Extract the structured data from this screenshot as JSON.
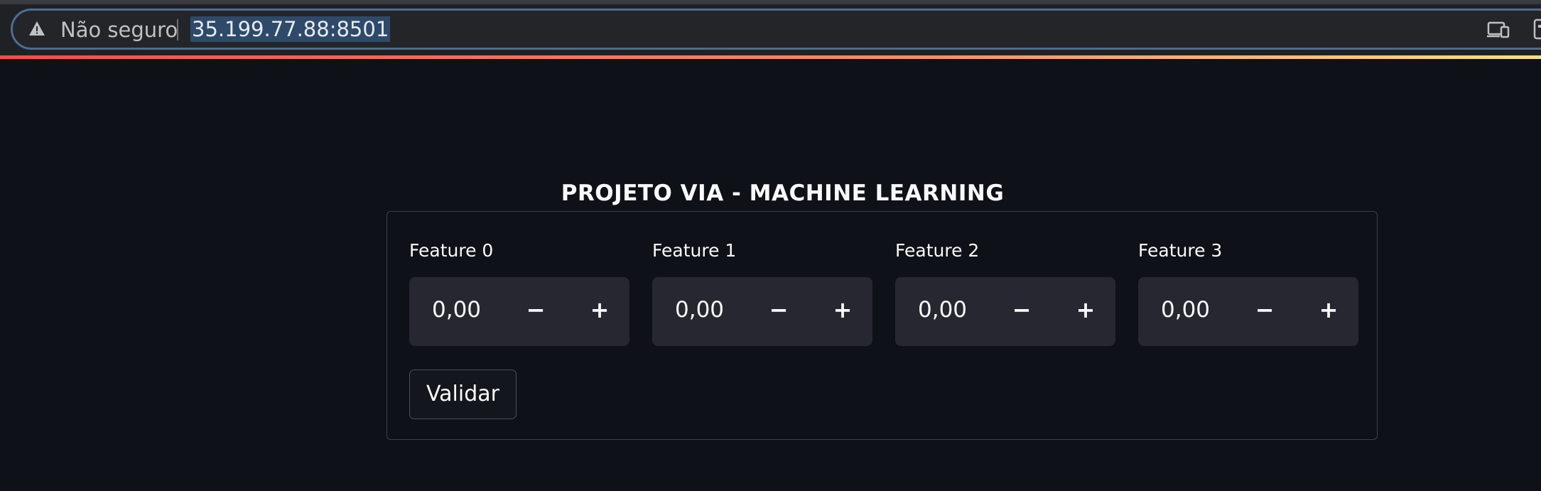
{
  "browser": {
    "security_label": "Não seguro",
    "url": "35.199.77.88:8501",
    "icons": {
      "warning": "warning-triangle-icon",
      "cast": "cast-icon",
      "extension": "extension-icon"
    }
  },
  "app": {
    "title": "PROJETO VIA - MACHINE LEARNING",
    "features": [
      {
        "label": "Feature 0",
        "value": "0,00",
        "minus": "−",
        "plus": "+"
      },
      {
        "label": "Feature 1",
        "value": "0,00",
        "minus": "−",
        "plus": "+"
      },
      {
        "label": "Feature 2",
        "value": "0,00",
        "minus": "−",
        "plus": "+"
      },
      {
        "label": "Feature 3",
        "value": "0,00",
        "minus": "−",
        "plus": "+"
      }
    ],
    "submit_label": "Validar"
  },
  "colors": {
    "background": "#0e1117",
    "input_bg": "#262730",
    "accent_gradient_start": "#ff4b4b",
    "accent_gradient_end": "#ffe07a"
  }
}
